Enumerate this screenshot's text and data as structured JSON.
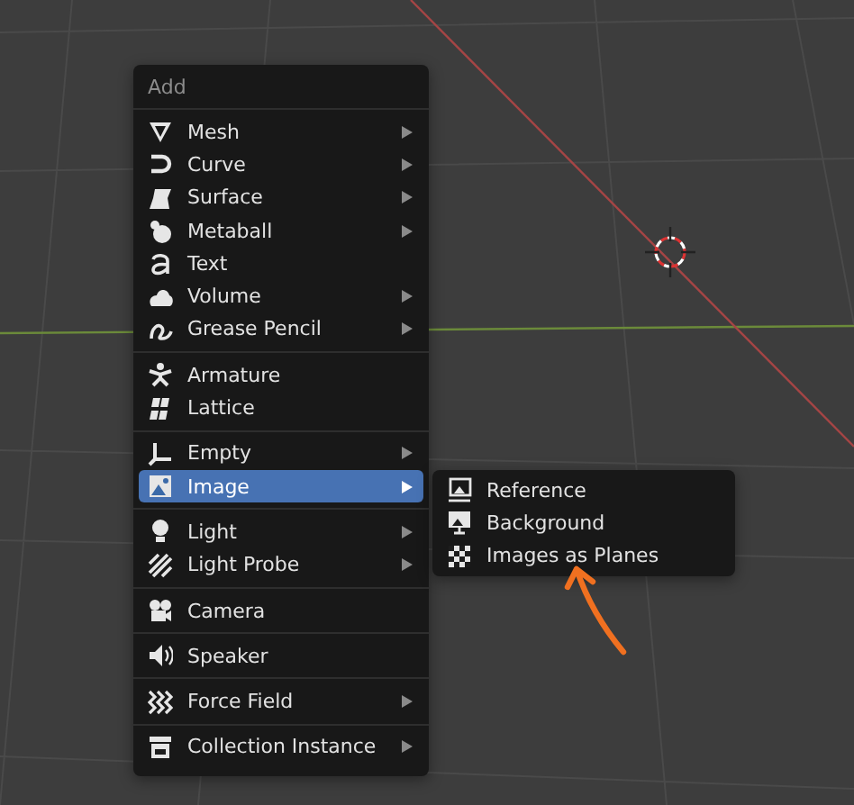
{
  "menu": {
    "title": "Add",
    "groups": [
      {
        "items": [
          {
            "label": "Mesh",
            "submenu": true,
            "selected": false
          },
          {
            "label": "Curve",
            "submenu": true,
            "selected": false
          },
          {
            "label": "Surface",
            "submenu": true,
            "selected": false
          },
          {
            "label": "Metaball",
            "submenu": true,
            "selected": false
          },
          {
            "label": "Text",
            "submenu": false,
            "selected": false
          },
          {
            "label": "Volume",
            "submenu": true,
            "selected": false
          },
          {
            "label": "Grease Pencil",
            "submenu": true,
            "selected": false
          }
        ]
      },
      {
        "items": [
          {
            "label": "Armature",
            "submenu": false,
            "selected": false
          },
          {
            "label": "Lattice",
            "submenu": false,
            "selected": false
          }
        ]
      },
      {
        "items": [
          {
            "label": "Empty",
            "submenu": true,
            "selected": false
          },
          {
            "label": "Image",
            "submenu": true,
            "selected": true
          }
        ]
      },
      {
        "items": [
          {
            "label": "Light",
            "submenu": true,
            "selected": false
          },
          {
            "label": "Light Probe",
            "submenu": true,
            "selected": false
          }
        ]
      },
      {
        "items": [
          {
            "label": "Camera",
            "submenu": false,
            "selected": false
          }
        ]
      },
      {
        "items": [
          {
            "label": "Speaker",
            "submenu": false,
            "selected": false
          }
        ]
      },
      {
        "items": [
          {
            "label": "Force Field",
            "submenu": true,
            "selected": false
          }
        ]
      },
      {
        "items": [
          {
            "label": "Collection Instance",
            "submenu": true,
            "selected": false
          }
        ]
      }
    ]
  },
  "submenu": {
    "items": [
      {
        "label": "Reference"
      },
      {
        "label": "Background"
      },
      {
        "label": "Images as Planes"
      }
    ]
  }
}
